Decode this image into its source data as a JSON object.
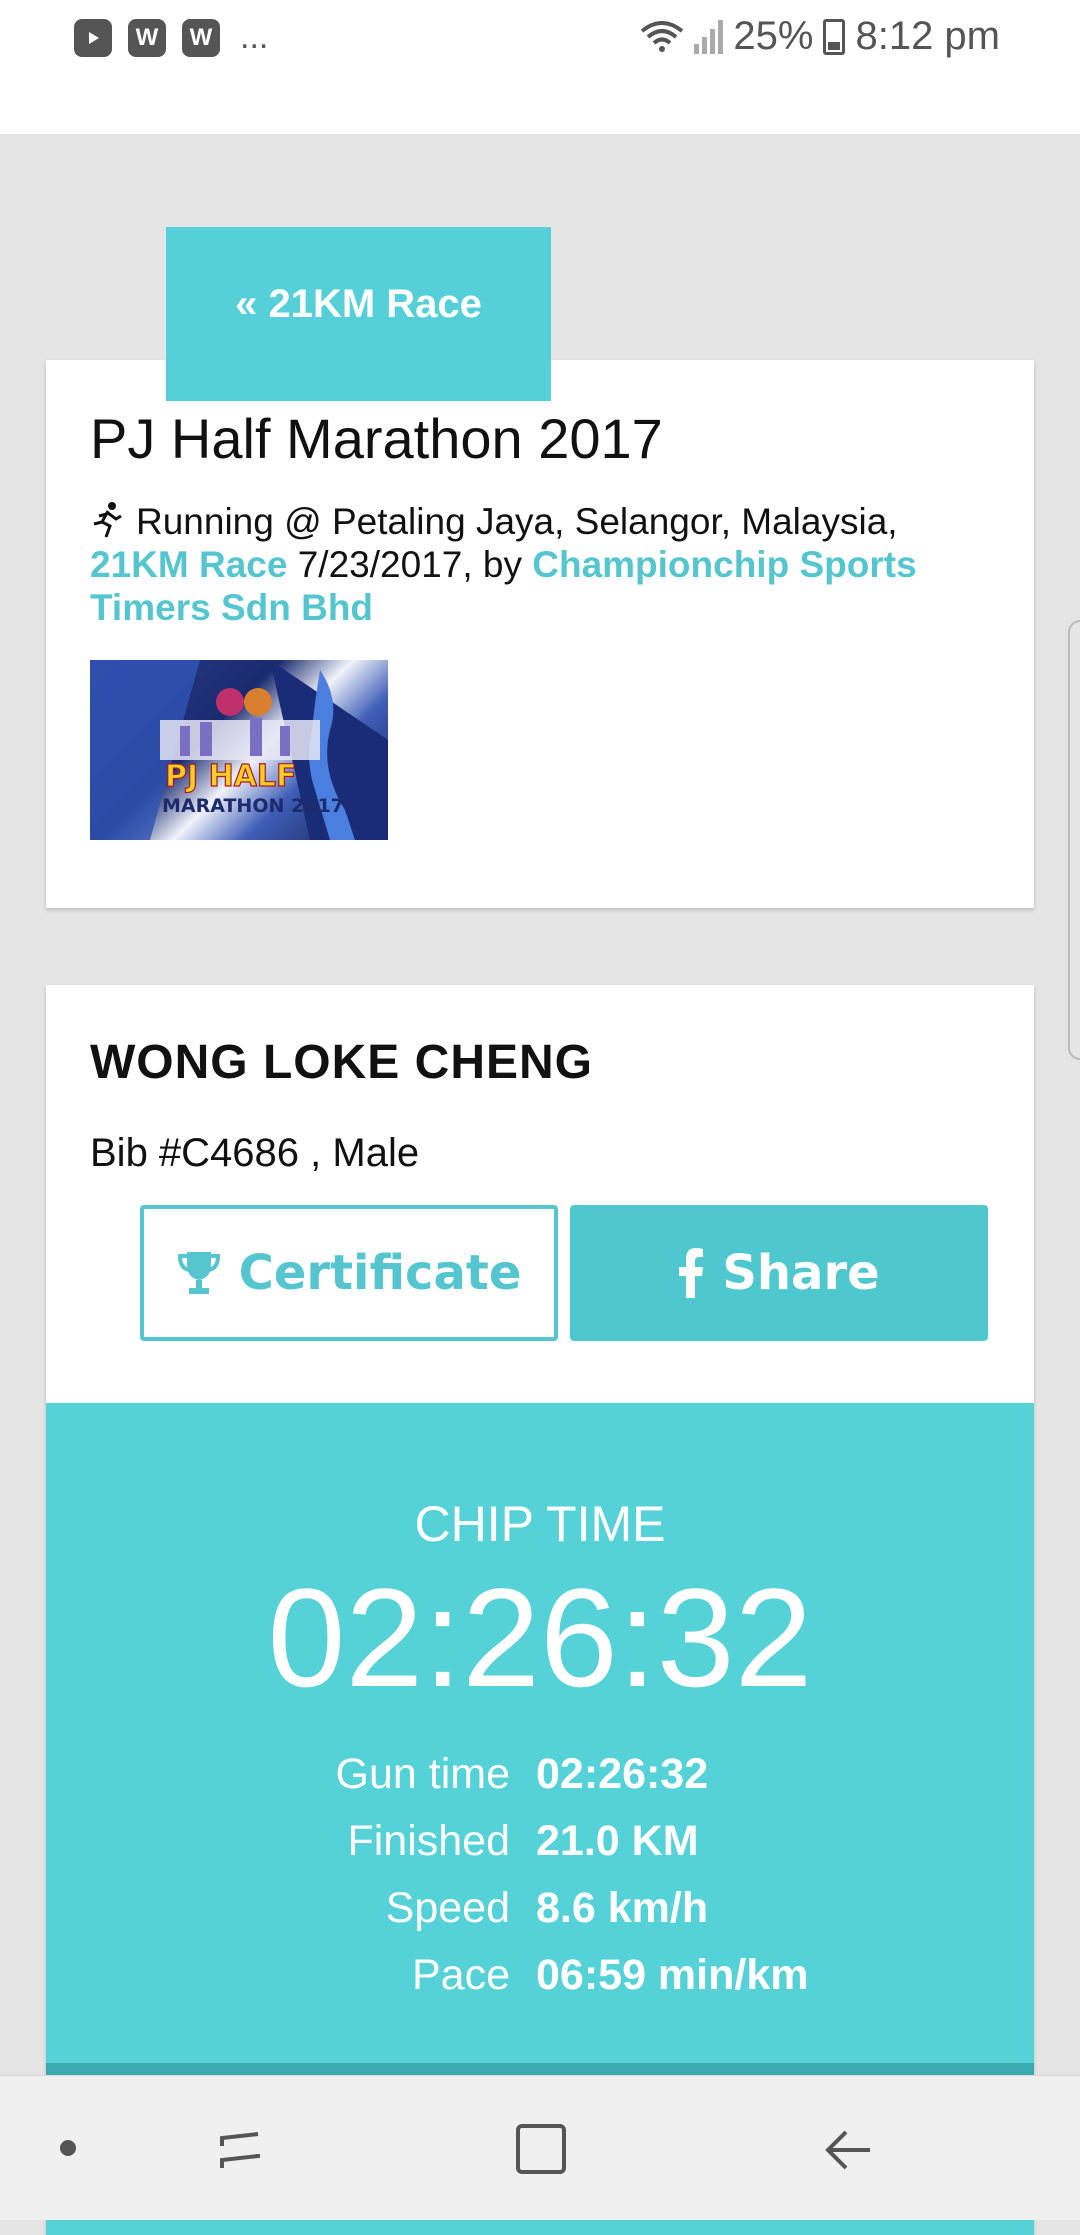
{
  "status_bar": {
    "apps": [
      "youtube-icon",
      "w-app-icon",
      "w-app-icon"
    ],
    "more": "...",
    "battery": "25%",
    "time": "8:12 pm"
  },
  "tab_button": {
    "label": "« 21KM Race"
  },
  "event": {
    "title": "PJ Half Marathon 2017",
    "activity": "Running @ Petaling Jaya, Selangor, Malaysia,",
    "race_link": "21KM Race",
    "date_by": "7/23/2017, by",
    "organizer_link": "Championchip Sports Timers Sdn Bhd",
    "logo": {
      "line1": "PJ HALF",
      "line2": "MARATHON 2017"
    }
  },
  "runner": {
    "name": "WONG LOKE CHENG",
    "bib_line": "Bib #C4686 , Male"
  },
  "buttons": {
    "certificate": "Certificate",
    "share": "Share"
  },
  "result": {
    "chip_label": "CHIP TIME",
    "chip_time": "02:26:32",
    "stats": [
      {
        "key": "Gun time",
        "value": "02:26:32"
      },
      {
        "key": "Finished",
        "value": "21.0 KM"
      },
      {
        "key": "Speed",
        "value": "8.6 km/h"
      },
      {
        "key": "Pace",
        "value": "06:59 min/km"
      }
    ]
  },
  "colors": {
    "accent": "#55d2d8",
    "link": "#55c6cf"
  }
}
